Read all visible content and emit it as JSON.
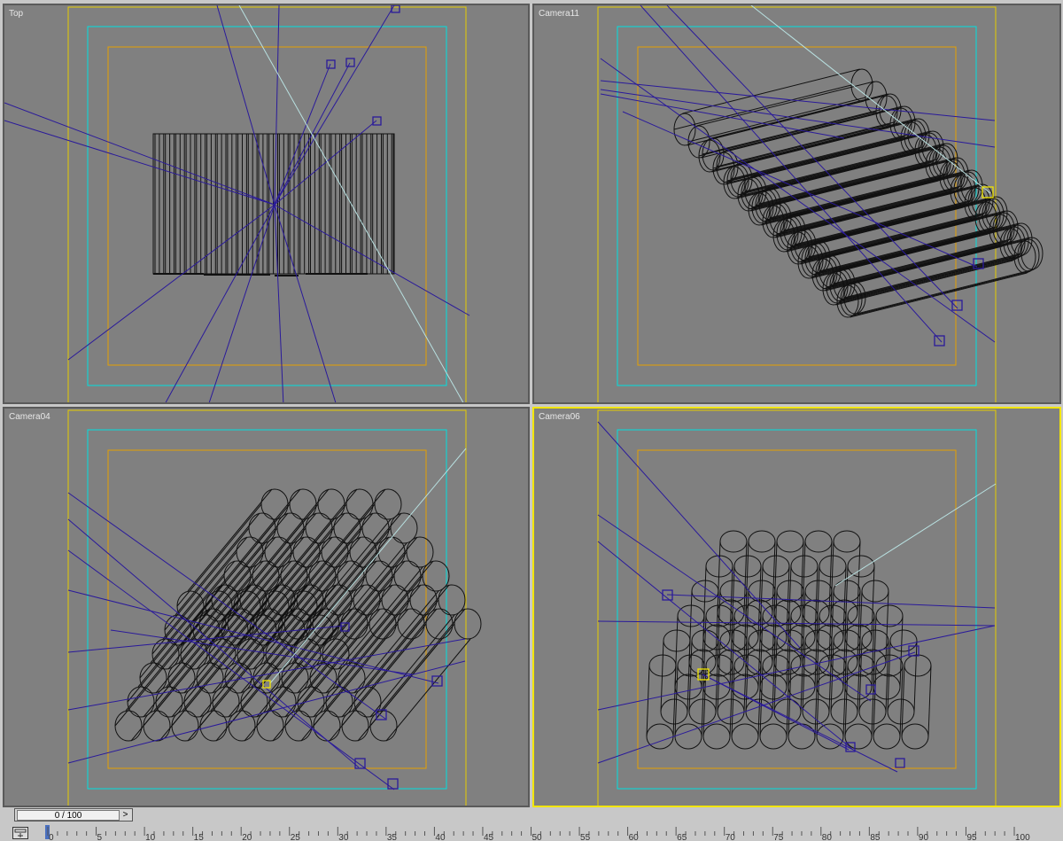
{
  "viewports": [
    {
      "id": "top",
      "label": "Top",
      "active": false
    },
    {
      "id": "camera11",
      "label": "Camera11",
      "active": false
    },
    {
      "id": "camera04",
      "label": "Camera04",
      "active": false
    },
    {
      "id": "camera06",
      "label": "Camera06",
      "active": true
    }
  ],
  "time_slider": {
    "value": "0 / 100",
    "next_arrow": ">"
  },
  "trackbar": {
    "labels": [
      "0",
      "5",
      "10",
      "15",
      "20",
      "25",
      "30",
      "35",
      "40",
      "45",
      "50",
      "55",
      "60",
      "65",
      "70",
      "75",
      "80",
      "85",
      "90",
      "95",
      "100"
    ]
  },
  "colors": {
    "viewport_bg": "#808080",
    "safe_frame_outer": "#e6cc00",
    "safe_frame_action": "#00e0e0",
    "safe_frame_title": "#e6a000",
    "camera_lines": "#2a1a9a",
    "light_line": "#b8e0e0",
    "active_border": "#f2e600",
    "wireframe": "#111111"
  }
}
